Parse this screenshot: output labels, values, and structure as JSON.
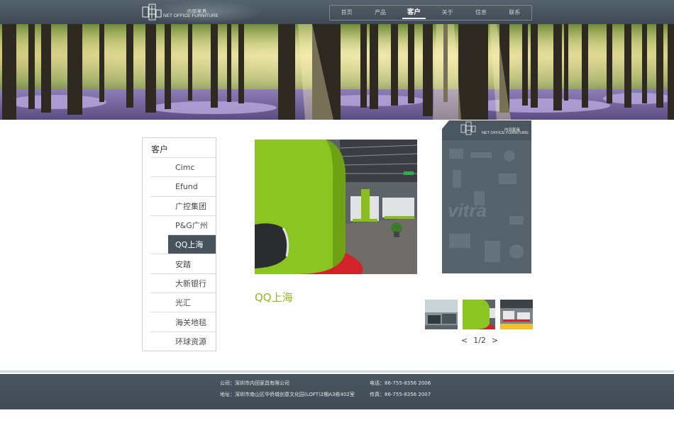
{
  "header": {
    "logo_cn": "内田家具",
    "logo_en": "NET OFFICE FURNITURE",
    "nav": [
      {
        "label": "首页"
      },
      {
        "label": "产品"
      },
      {
        "label": "客户"
      },
      {
        "label": "关于"
      },
      {
        "label": "信息"
      },
      {
        "label": "联系"
      }
    ],
    "active_nav": "客户"
  },
  "sidebar": {
    "title": "客户",
    "items": [
      {
        "label": "Cimc"
      },
      {
        "label": "Efund"
      },
      {
        "label": "广控集团"
      },
      {
        "label": "P&G广州"
      },
      {
        "label": "QQ上海"
      },
      {
        "label": "安踏"
      },
      {
        "label": "大新银行"
      },
      {
        "label": "光汇"
      },
      {
        "label": "海关地毯"
      },
      {
        "label": "环球资源"
      }
    ],
    "active_item": "QQ上海"
  },
  "main": {
    "project_title": "QQ上海",
    "accent_color": "#8cbd1e"
  },
  "brand_panel": {
    "logo_cn": "内田家具",
    "logo_en": "NET OFFICE FURNITURE",
    "watermark": "vitra"
  },
  "gallery": {
    "prev": "<",
    "page": "1/2",
    "next": ">"
  },
  "footer": {
    "company": "公司：深圳市内田家具有限公司",
    "address": "地址：深圳市南山区华侨城创意文化园(LOFT)2期A3栋402室",
    "phone": "电话：86-755-8356 2006",
    "fax": "传真：86-755-8356 2007"
  },
  "colors": {
    "header_bg": "#46525c",
    "footer_bg": "#46525c",
    "active_sidebar_bg": "#46525c"
  }
}
